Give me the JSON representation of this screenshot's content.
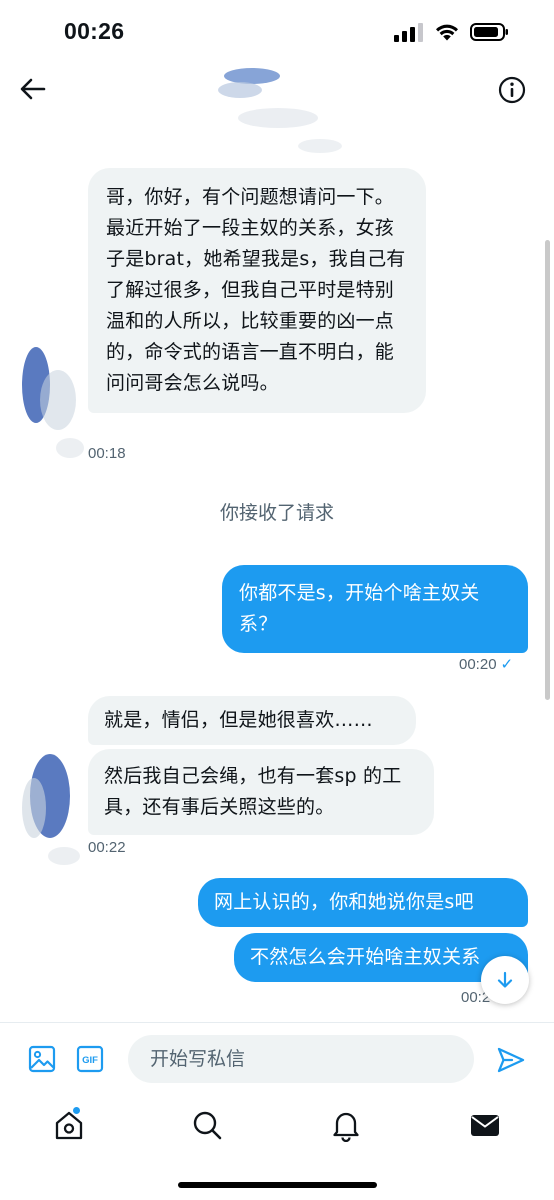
{
  "status_bar": {
    "time": "00:26"
  },
  "header": {
    "back_icon": "arrow-left-icon",
    "info_icon": "info-icon"
  },
  "messages": [
    {
      "direction": "in",
      "text": "哥，你好，有个问题想请问一下。最近开始了一段主奴的关系，女孩子是brat，她希望我是s，我自己有了解过很多，但我自己平时是特别温和的人所以，比较重要的凶一点的，命令式的语言一直不明白，能问问哥会怎么说吗。",
      "time": "00:18"
    },
    {
      "direction": "out",
      "text": "你都不是s，开始个啥主奴关系？",
      "time": "00:20"
    },
    {
      "direction": "in",
      "text": "就是，情侣，但是她很喜欢……"
    },
    {
      "direction": "in",
      "text": "然后我自己会绳，也有一套sp 的工具，还有事后关照这些的。",
      "time": "00:22"
    },
    {
      "direction": "out",
      "text": "网上认识的，你和她说你是s吧"
    },
    {
      "direction": "out",
      "text": "不然怎么会开始啥主奴关系",
      "time": "00:2"
    }
  ],
  "system_note": "你接收了请求",
  "compose": {
    "placeholder": "开始写私信",
    "image_icon": "image-icon",
    "gif_label": "GIF",
    "send_icon": "send-icon"
  },
  "bottom_nav": [
    "home-icon",
    "search-icon",
    "bell-icon",
    "mail-icon"
  ],
  "colors": {
    "accent": "#1d9bf0",
    "bubble_in": "#eff3f4",
    "muted": "#536471"
  }
}
